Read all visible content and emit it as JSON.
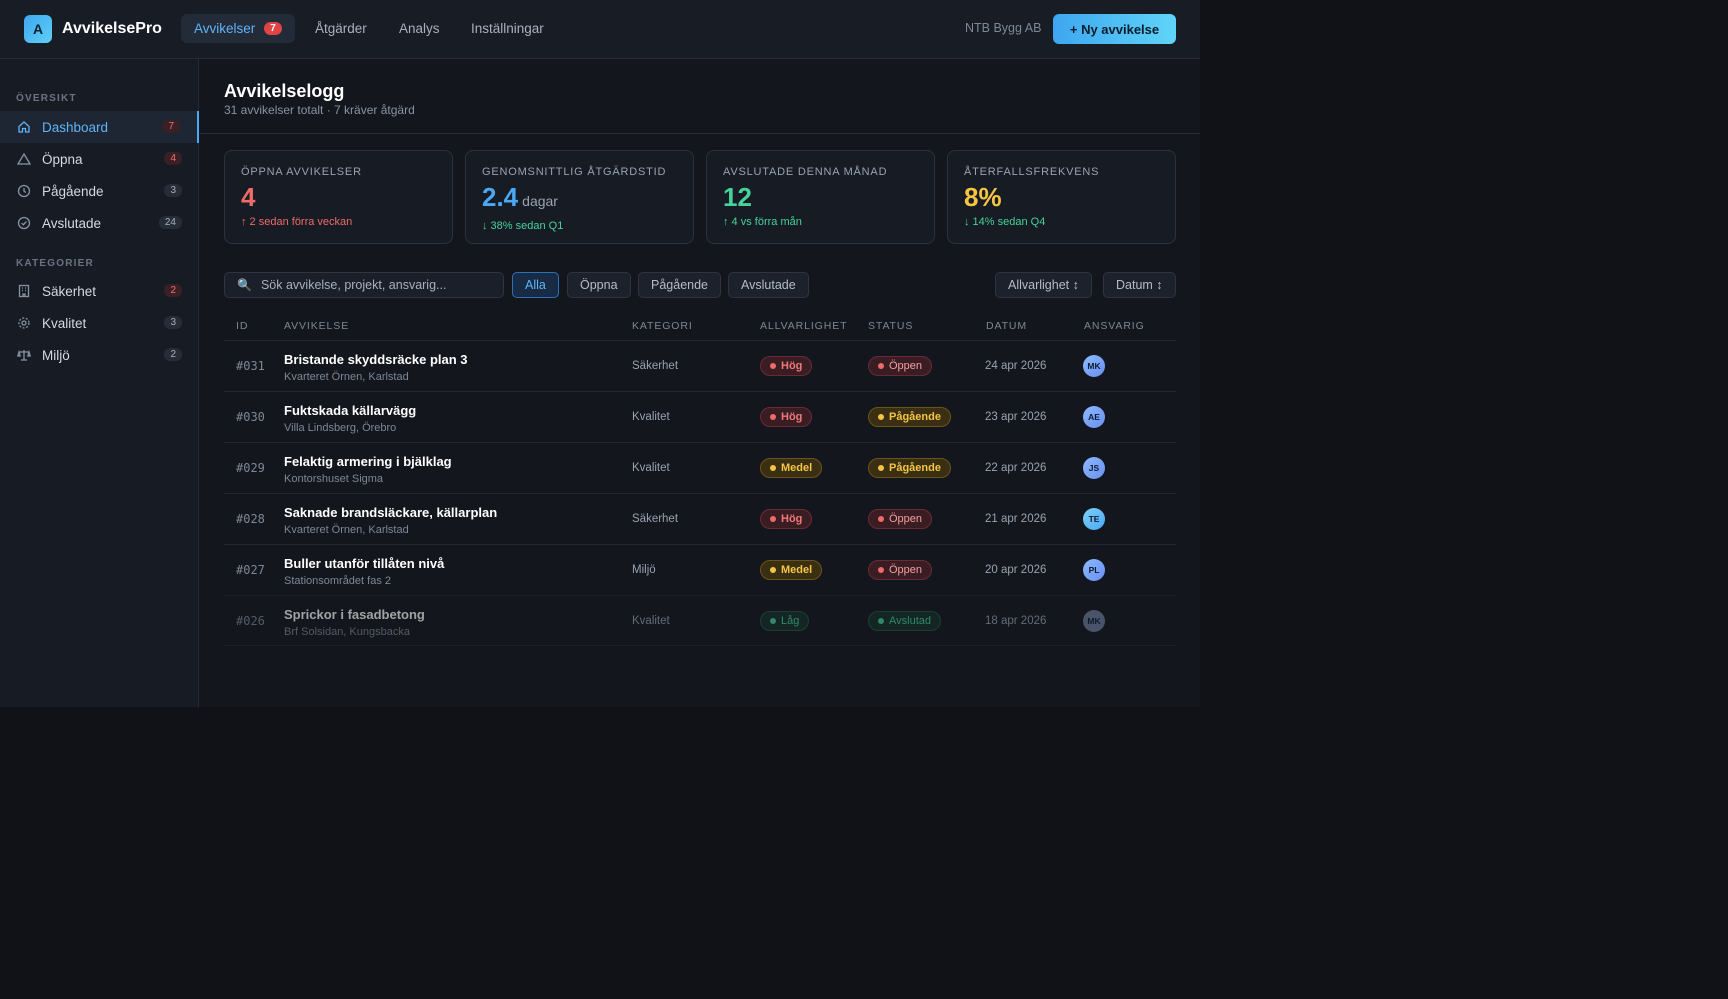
{
  "app": {
    "logo_letter": "A",
    "brand": "AvvikelsePro",
    "company": "NTB Bygg AB",
    "new_button": "+ Ny avvikelse"
  },
  "nav": {
    "tabs": [
      {
        "label": "Avvikelser",
        "badge": "7",
        "active": true
      },
      {
        "label": "Åtgärder"
      },
      {
        "label": "Analys"
      },
      {
        "label": "Inställningar"
      }
    ]
  },
  "sidebar": {
    "section_overview": "ÖVERSIKT",
    "section_categories": "KATEGORIER",
    "overview_items": [
      {
        "label": "Dashboard",
        "count": "7",
        "icon": "home-icon"
      },
      {
        "label": "Öppna",
        "count": "4",
        "icon": "warning-triangle-icon"
      },
      {
        "label": "Pågående",
        "count": "3",
        "icon": "clock-icon"
      },
      {
        "label": "Avslutade",
        "count": "24",
        "icon": "check-circle-icon"
      }
    ],
    "category_items": [
      {
        "label": "Säkerhet",
        "count": "2",
        "icon": "building-icon"
      },
      {
        "label": "Kvalitet",
        "count": "3",
        "icon": "gear-icon"
      },
      {
        "label": "Miljö",
        "count": "2",
        "icon": "scale-icon"
      }
    ]
  },
  "page": {
    "title": "Avvikelselogg",
    "subtitle": "31 avvikelser totalt · 7 kräver åtgärd"
  },
  "stats": [
    {
      "label": "ÖPPNA AVVIKELSER",
      "value": "4",
      "unit": "",
      "delta": "↑ 2 sedan förra veckan",
      "color": "#f06a6a",
      "delta_color": "#f06a6a"
    },
    {
      "label": "GENOMSNITTLIG ÅTGÄRDSTID",
      "value": "2.4",
      "unit": "dagar",
      "delta": "↓ 38% sedan Q1",
      "color": "#4aa8f5",
      "delta_color": "#46d39a"
    },
    {
      "label": "AVSLUTADE DENNA MÅNAD",
      "value": "12",
      "unit": "",
      "delta": "↑ 4 vs förra mån",
      "color": "#46d39a",
      "delta_color": "#46d39a"
    },
    {
      "label": "ÅTERFALLSFREKVENS",
      "value": "8%",
      "unit": "",
      "delta": "↓ 14% sedan Q4",
      "color": "#f5c542",
      "delta_color": "#46d39a"
    }
  ],
  "filters": {
    "search_placeholder": "Sök avvikelse, projekt, ansvarig...",
    "chips": [
      "Alla",
      "Öppna",
      "Pågående",
      "Avslutade"
    ],
    "sort_severity": "Allvarlighet ↕",
    "sort_date": "Datum ↕"
  },
  "table": {
    "headers": [
      "ID",
      "AVVIKELSE",
      "KATEGORI",
      "ALLVARLIGHET",
      "STATUS",
      "DATUM",
      "ANSVARIG"
    ],
    "rows": [
      {
        "id": "#031",
        "title": "Bristande skyddsräcke plan 3",
        "sub": "Kvarteret Örnen, Karlstad",
        "category": "Säkerhet",
        "severity": "Hög",
        "status": "Öppen",
        "date": "24 apr 2026",
        "owner": "MK"
      },
      {
        "id": "#030",
        "title": "Fuktskada källarvägg",
        "sub": "Villa Lindsberg, Örebro",
        "category": "Kvalitet",
        "severity": "Hög",
        "status": "Pågående",
        "date": "23 apr 2026",
        "owner": "AE"
      },
      {
        "id": "#029",
        "title": "Felaktig armering i bjälklag",
        "sub": "Kontorshuset Sigma",
        "category": "Kvalitet",
        "severity": "Medel",
        "status": "Pågående",
        "date": "22 apr 2026",
        "owner": "JS"
      },
      {
        "id": "#028",
        "title": "Saknade brandsläckare, källarplan",
        "sub": "Kvarteret Örnen, Karlstad",
        "category": "Säkerhet",
        "severity": "Hög",
        "status": "Öppen",
        "date": "21 apr 2026",
        "owner": "TE"
      },
      {
        "id": "#027",
        "title": "Buller utanför tillåten nivå",
        "sub": "Stationsområdet fas 2",
        "category": "Miljö",
        "severity": "Medel",
        "status": "Öppen",
        "date": "20 apr 2026",
        "owner": "PL"
      },
      {
        "id": "#026",
        "title": "Sprickor i fasadbetong",
        "sub": "Brf Solsidan, Kungsbacka",
        "category": "Kvalitet",
        "severity": "Låg",
        "status": "Avslutad",
        "date": "18 apr 2026",
        "owner": "MK"
      }
    ]
  }
}
